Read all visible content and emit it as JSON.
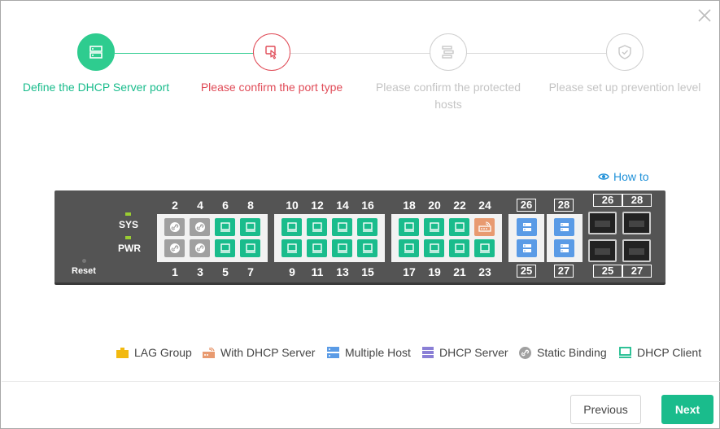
{
  "steps": [
    {
      "label": "Define the DHCP Server port",
      "state": "done",
      "icon": "server-icon"
    },
    {
      "label": "Please confirm the port type",
      "state": "current",
      "icon": "touch-click-icon"
    },
    {
      "label": "Please confirm the protected hosts",
      "state": "pending",
      "icon": "host-list-icon"
    },
    {
      "label": "Please set up prevention level",
      "state": "pending",
      "icon": "shield-check-icon"
    }
  ],
  "how_to": "How to",
  "panel": {
    "sys": "SYS",
    "pwr": "PWR",
    "reset": "Reset",
    "top_ports": [
      "2",
      "4",
      "6",
      "8",
      "10",
      "12",
      "14",
      "16",
      "18",
      "20",
      "22",
      "24"
    ],
    "bottom_ports": [
      "1",
      "3",
      "5",
      "7",
      "9",
      "11",
      "13",
      "15",
      "17",
      "19",
      "21",
      "23"
    ],
    "combo_top": [
      "26",
      "28"
    ],
    "combo_bottom": [
      "25",
      "27"
    ],
    "sfp_top": [
      "26",
      "28"
    ],
    "sfp_bottom": [
      "25",
      "27"
    ]
  },
  "legend": [
    {
      "label": "LAG Group",
      "icon": "lag-group-icon",
      "color": "#f2b90f"
    },
    {
      "label": "With DHCP Server",
      "icon": "with-dhcp-server-icon",
      "color": "#e89a70"
    },
    {
      "label": "Multiple Host",
      "icon": "multiple-host-icon",
      "color": "#5a9be6"
    },
    {
      "label": "DHCP Server",
      "icon": "dhcp-server-icon",
      "color": "#8a7fd6"
    },
    {
      "label": "Static Binding",
      "icon": "static-binding-icon",
      "color": "#a0a0a0"
    },
    {
      "label": "DHCP Client",
      "icon": "dhcp-client-icon",
      "color": "#1abc8c"
    }
  ],
  "buttons": {
    "previous": "Previous",
    "next": "Next"
  },
  "colors": {
    "accent": "#1abc8c",
    "current": "#e04b57",
    "pending": "#c8c8c8",
    "link": "#1e90d8"
  }
}
